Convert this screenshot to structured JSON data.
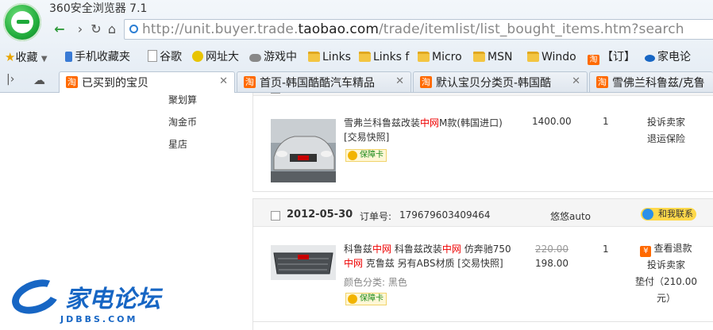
{
  "window": {
    "title": "360安全浏览器 7.1"
  },
  "address": {
    "url_prefix": "http://unit.buyer.trade.",
    "url_domain": "taobao.com",
    "url_suffix": "/trade/itemlist/list_bought_items.htm?search"
  },
  "bookmarks": [
    {
      "label": "收藏",
      "icon": "star-icon"
    },
    {
      "label": "手机收藏夹",
      "icon": "phone-icon"
    },
    {
      "label": "谷歌",
      "icon": "page-icon"
    },
    {
      "label": "网址大",
      "icon": "site-icon"
    },
    {
      "label": "游戏中",
      "icon": "gamepad-icon"
    },
    {
      "label": "Links",
      "icon": "folder-icon"
    },
    {
      "label": "Links f",
      "icon": "folder-icon"
    },
    {
      "label": "Micro",
      "icon": "folder-icon"
    },
    {
      "label": "MSN",
      "icon": "folder-icon"
    },
    {
      "label": "Windo",
      "icon": "folder-icon"
    },
    {
      "label": "【订】",
      "icon": "taobao-icon"
    },
    {
      "label": "家电论",
      "icon": "site-icon"
    }
  ],
  "tabs": [
    {
      "label": "已买到的宝贝",
      "active": true
    },
    {
      "label": "首页-韩国酷酷汽车精品",
      "active": false
    },
    {
      "label": "默认宝贝分类页-韩国酷",
      "active": false
    },
    {
      "label": "雪佛兰科鲁兹/克鲁",
      "active": false
    }
  ],
  "icons": {
    "tab": "淘",
    "refund": "¥"
  },
  "sidebar": {
    "items": [
      "聚划算",
      "淘金币",
      "星店"
    ]
  },
  "orders": [
    {
      "item": {
        "title_parts": [
          "雪弗兰科鲁兹改装",
          "中网",
          "M款(韩国进口)"
        ],
        "snapshot": "[交易快照]",
        "price": "1400.00",
        "qty": "1",
        "actions": [
          "投诉卖家",
          "退运保险"
        ],
        "badge": "保障卡"
      }
    },
    {
      "date": "2012-05-30",
      "order_label": "订单号:",
      "order_no": "179679603409464",
      "seller": "悠悠auto",
      "contact": "和我联系",
      "item": {
        "title_line1": [
          "科鲁兹",
          "中网",
          " 科鲁兹改装",
          "中网",
          " 仿奔驰750"
        ],
        "title_line2": [
          "中网",
          " 克鲁兹 另有ABS材质 [交易快照]"
        ],
        "attr": "颜色分类: 黑色",
        "orig_price": "220.00",
        "price": "198.00",
        "qty": "1",
        "actions": [
          "查看退款",
          "投诉卖家",
          "垫付（210.00",
          "元）"
        ],
        "badge": "保障卡"
      }
    }
  ],
  "watermark": {
    "name": "家电论坛",
    "url": "JDBBS.COM"
  },
  "colors": {
    "accent": "#ff6a00",
    "link_red": "#e00000",
    "brand_blue": "#1766c4"
  }
}
